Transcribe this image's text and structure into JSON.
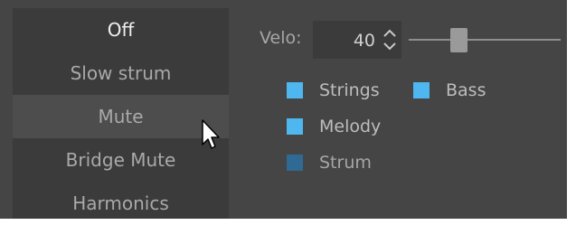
{
  "modes": [
    {
      "label": "Off",
      "selected": true,
      "hovered": false
    },
    {
      "label": "Slow strum",
      "selected": false,
      "hovered": false
    },
    {
      "label": "Mute",
      "selected": false,
      "hovered": true
    },
    {
      "label": "Bridge Mute",
      "selected": false,
      "hovered": false
    },
    {
      "label": "Harmonics",
      "selected": false,
      "hovered": false
    }
  ],
  "velocity": {
    "label": "Velo:",
    "value": "40"
  },
  "options": {
    "strings": {
      "label": "Strings",
      "checked": true
    },
    "bass": {
      "label": "Bass",
      "checked": true
    },
    "melody": {
      "label": "Melody",
      "checked": true
    },
    "strum": {
      "label": "Strum",
      "checked": false
    }
  },
  "colors": {
    "checked": "#4fb7ef",
    "unchecked": "#2e6a94",
    "panel": "#454545",
    "list": "#3b3b3b"
  }
}
